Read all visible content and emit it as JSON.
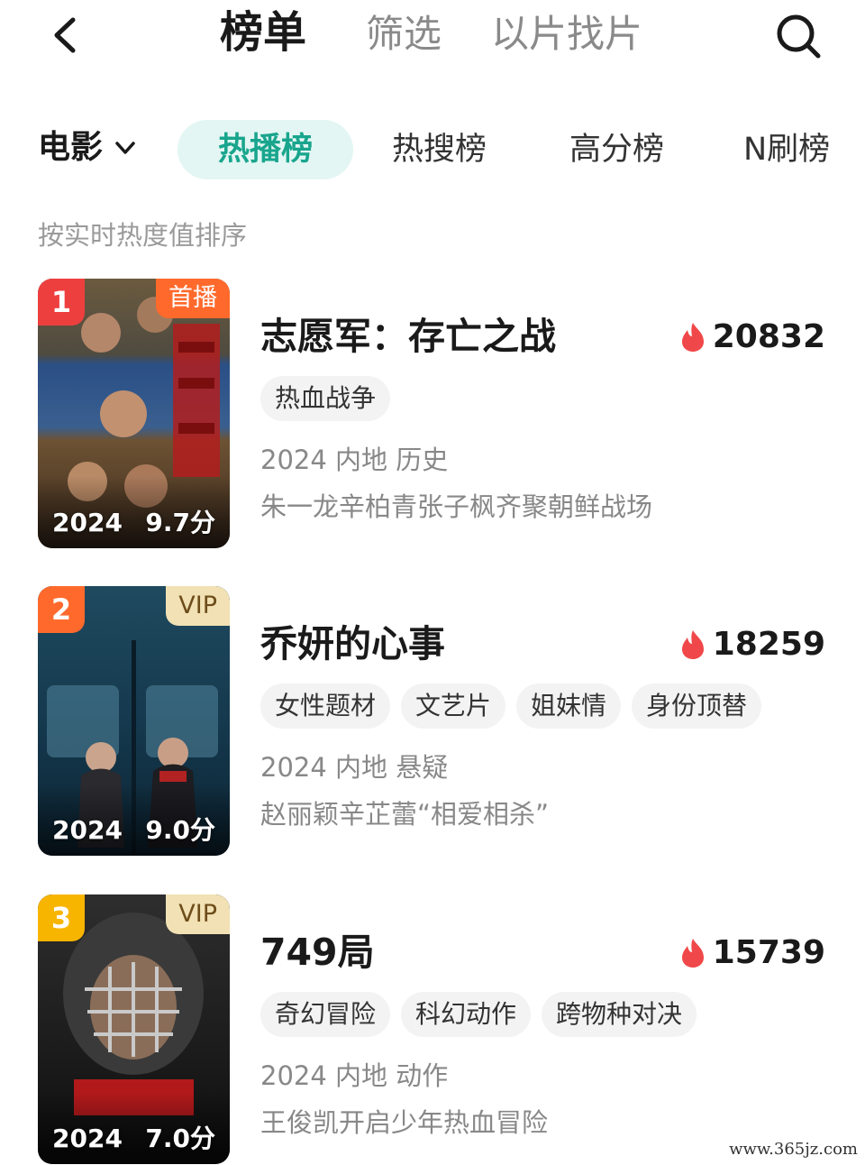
{
  "header": {
    "tabs": [
      {
        "label": "榜单",
        "active": true
      },
      {
        "label": "筛选",
        "active": false
      },
      {
        "label": "以片找片",
        "active": false
      }
    ]
  },
  "category": {
    "selected": "电影",
    "chart_tabs": [
      {
        "label": "热播榜",
        "active": true
      },
      {
        "label": "热搜榜",
        "active": false
      },
      {
        "label": "高分榜",
        "active": false
      },
      {
        "label": "N刷榜",
        "active": false
      }
    ]
  },
  "sort_note": "按实时热度值排序",
  "items": [
    {
      "rank": "1",
      "badge": "首播",
      "poster_year": "2024",
      "poster_score": "9.7分",
      "title": "志愿军：存亡之战",
      "heat": "20832",
      "tags": [
        "热血战争"
      ],
      "meta": "2024 内地 历史",
      "desc": "朱一龙辛柏青张子枫齐聚朝鲜战场"
    },
    {
      "rank": "2",
      "badge": "VIP",
      "poster_year": "2024",
      "poster_score": "9.0分",
      "title": "乔妍的心事",
      "heat": "18259",
      "tags": [
        "女性题材",
        "文艺片",
        "姐妹情",
        "身份顶替"
      ],
      "meta": "2024 内地 悬疑",
      "desc": "赵丽颖辛芷蕾“相爱相杀”"
    },
    {
      "rank": "3",
      "badge": "VIP",
      "poster_year": "2024",
      "poster_score": "7.0分",
      "title": "749局",
      "heat": "15739",
      "tags": [
        "奇幻冒险",
        "科幻动作",
        "跨物种对决"
      ],
      "meta": "2024 内地 动作",
      "desc": "王俊凯开启少年热血冒险"
    }
  ],
  "colors": {
    "accent": "#19a58d",
    "accent_bg": "#e3f6f3",
    "flame": "#f0484a",
    "rank1": "#ee3f3f",
    "rank2": "#ff6a2c",
    "rank3": "#f8b500"
  },
  "watermark": "www.365jz.com"
}
